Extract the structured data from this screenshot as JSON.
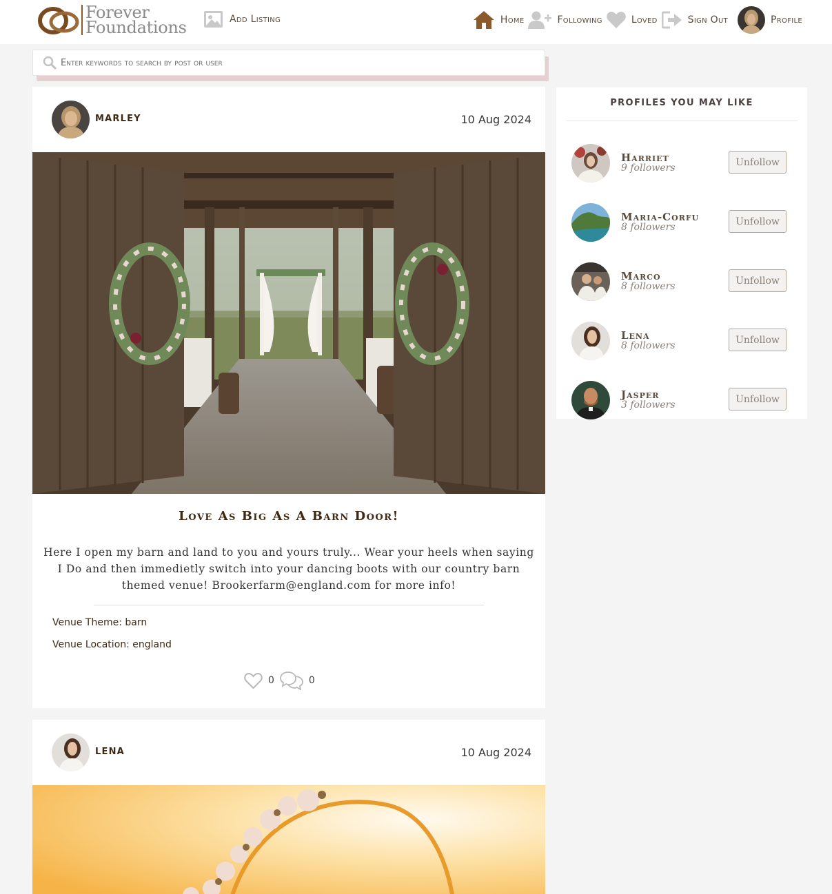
{
  "brand": {
    "name_line1": "Forever",
    "name_line2": "Foundations"
  },
  "nav": {
    "add_listing": "Add Listing",
    "home": "Home",
    "following": "Following",
    "loved": "Loved",
    "sign_out": "Sign Out",
    "profile": "Profile"
  },
  "search": {
    "placeholder": "Enter keywords to search by post or user"
  },
  "posts": [
    {
      "user": "MARLEY",
      "date": "10 Aug 2024",
      "title": "Love As Big As A Barn Door!",
      "body": "Here I open my barn and land to you and yours truly... Wear your heels when saying I Do and then immedietly switch into your dancing boots with our country barn themed venue! Brookerfarm@england.com for more info!",
      "venue_theme": "Venue Theme: barn",
      "venue_location": "Venue Location: england",
      "likes": "0",
      "comments": "0"
    },
    {
      "user": "LENA",
      "date": "10 Aug 2024"
    }
  ],
  "sidebar": {
    "title": "PROFILES YOU MAY LIKE",
    "profiles": [
      {
        "name": "Harriet",
        "followers": "9 followers",
        "button": "Unfollow"
      },
      {
        "name": "Maria-Corfu",
        "followers": "8 followers",
        "button": "Unfollow"
      },
      {
        "name": "Marco",
        "followers": "8 followers",
        "button": "Unfollow"
      },
      {
        "name": "Lena",
        "followers": "8 followers",
        "button": "Unfollow"
      },
      {
        "name": "Jasper",
        "followers": "3 followers",
        "button": "Unfollow"
      }
    ]
  },
  "colors": {
    "brand_brown": "#8b5a2b",
    "icon_grey": "#c8c8c8",
    "search_shadow": "#e6cfd0"
  }
}
